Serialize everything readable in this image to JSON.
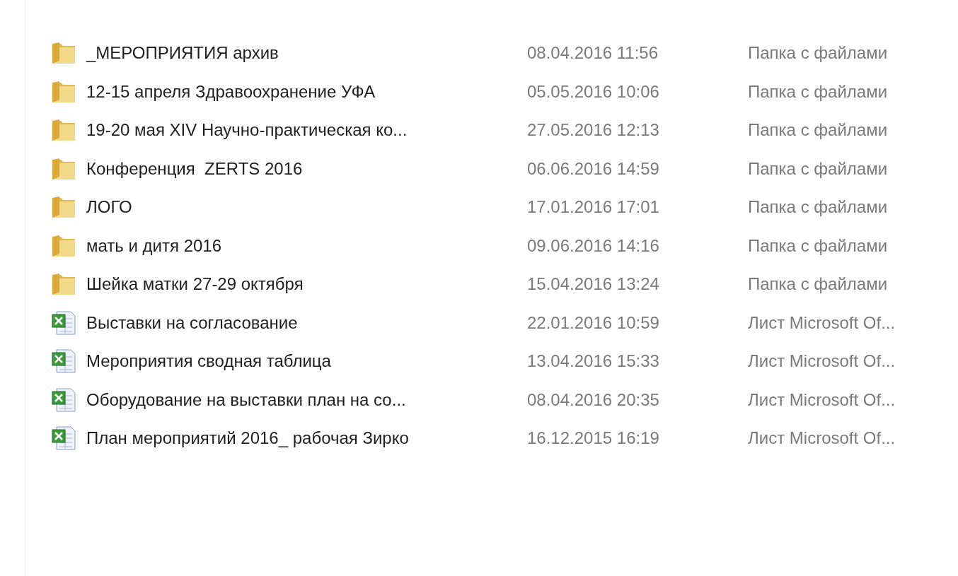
{
  "files": [
    {
      "kind": "folder",
      "name": "_МЕРОПРИЯТИЯ архив",
      "date": "08.04.2016 11:56",
      "type": "Папка с файлами"
    },
    {
      "kind": "folder",
      "name": "12-15 апреля Здравоохранение УФА",
      "date": "05.05.2016 10:06",
      "type": "Папка с файлами"
    },
    {
      "kind": "folder",
      "name": "19-20 мая XIV Научно-практическая ко...",
      "date": "27.05.2016 12:13",
      "type": "Папка с файлами"
    },
    {
      "kind": "folder",
      "name": "Конференция  ZERTS 2016",
      "date": "06.06.2016 14:59",
      "type": "Папка с файлами"
    },
    {
      "kind": "folder",
      "name": "ЛОГО",
      "date": "17.01.2016 17:01",
      "type": "Папка с файлами"
    },
    {
      "kind": "folder",
      "name": "мать и дитя 2016",
      "date": "09.06.2016 14:16",
      "type": "Папка с файлами"
    },
    {
      "kind": "folder",
      "name": "Шейка матки 27-29 октября",
      "date": "15.04.2016 13:24",
      "type": "Папка с файлами"
    },
    {
      "kind": "sheet",
      "name": "Выставки на согласование",
      "date": "22.01.2016 10:59",
      "type": "Лист Microsoft Of..."
    },
    {
      "kind": "sheet",
      "name": "Мероприятия сводная таблица",
      "date": "13.04.2016 15:33",
      "type": "Лист Microsoft Of..."
    },
    {
      "kind": "sheet",
      "name": "Оборудование на выставки план на со...",
      "date": "08.04.2016 20:35",
      "type": "Лист Microsoft Of..."
    },
    {
      "kind": "sheet",
      "name": "План мероприятий 2016_ рабочая Зирко",
      "date": "16.12.2015 16:19",
      "type": "Лист Microsoft Of..."
    }
  ]
}
